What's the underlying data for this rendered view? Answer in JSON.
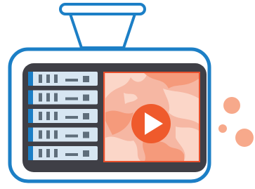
{
  "illustration": {
    "subject": "dashcam-video-server",
    "icons": {
      "mount": "mount-bracket-icon",
      "server_rack": "server-rack-icon",
      "video_screen": "video-screen-icon",
      "play": "play-icon",
      "bubbles": "decorative-bubbles"
    },
    "server_units": 5,
    "colors": {
      "outline_blue": "#1c7fc6",
      "mount_fill": "#ffffff",
      "body_fill": "#ffffff",
      "inner_bezel": "#3f3f46",
      "server_fill": "#d7e6f2",
      "server_slot": "#5f6e7b",
      "server_side": "#1c7fc6",
      "screen_bg": "#f6b7a3",
      "screen_border": "#e84f2c",
      "shape_light": "#fbd6c8",
      "shape_dark": "#f59a7b",
      "play_circle": "#ef5a2c",
      "play_triangle": "#ffffff",
      "bubble": "#f7a98b"
    }
  }
}
